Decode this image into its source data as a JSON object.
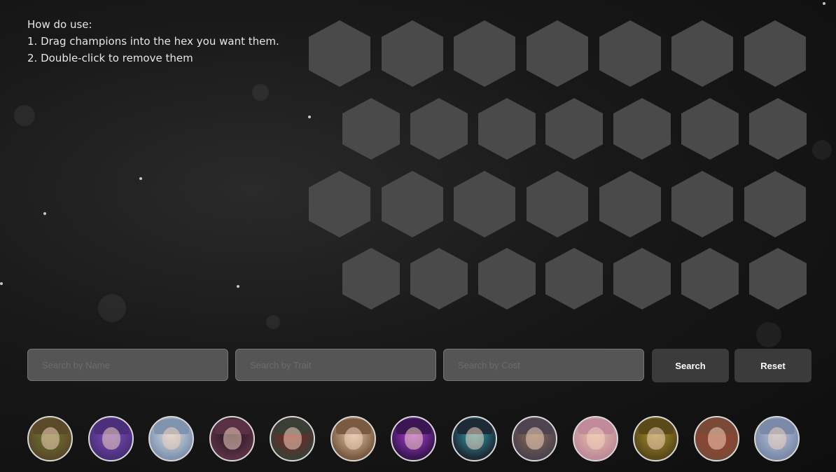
{
  "instructions": {
    "title": "How do use:",
    "step1": "1. Drag champions into the hex you want them.",
    "step2": "2. Double-click to remove them"
  },
  "board": {
    "rows": 4,
    "hexes_per_row": 7
  },
  "search": {
    "name_placeholder": "Search by Name",
    "trait_placeholder": "Search by Trait",
    "cost_placeholder": "Search by Cost",
    "search_label": "Search",
    "reset_label": "Reset"
  },
  "champions": [
    {
      "icon": "champion-portrait-green-elf",
      "color": "#5b4a2a",
      "accent": "#6d7a2c"
    },
    {
      "icon": "champion-portrait-purple-beast",
      "color": "#4b2f7a",
      "accent": "#7a4fc0"
    },
    {
      "icon": "champion-portrait-white-knight",
      "color": "#8094b0",
      "accent": "#d7dbe2"
    },
    {
      "icon": "champion-portrait-dark-hair-woman",
      "color": "#5a3045",
      "accent": "#221520"
    },
    {
      "icon": "champion-portrait-masked-warrior",
      "color": "#3a3f36",
      "accent": "#8a1f22"
    },
    {
      "icon": "champion-portrait-golden-helmet",
      "color": "#7a5a40",
      "accent": "#e0c8a6"
    },
    {
      "icon": "champion-portrait-purple-void",
      "color": "#3a1652",
      "accent": "#b040e0"
    },
    {
      "icon": "champion-portrait-dark-creature",
      "color": "#1e2a35",
      "accent": "#2fa3b0"
    },
    {
      "icon": "champion-portrait-brown-hair",
      "color": "#4e4350",
      "accent": "#8a6b52"
    },
    {
      "icon": "champion-portrait-yordle-girl",
      "color": "#c08a9a",
      "accent": "#e8c0a8"
    },
    {
      "icon": "champion-portrait-golden-lizard",
      "color": "#5a4a1a",
      "accent": "#a89028"
    },
    {
      "icon": "champion-portrait-red-hair-woman",
      "color": "#7a4a38",
      "accent": "#a0402a"
    },
    {
      "icon": "champion-portrait-blue-yordle",
      "color": "#7a8aa8",
      "accent": "#b8c4de"
    }
  ]
}
